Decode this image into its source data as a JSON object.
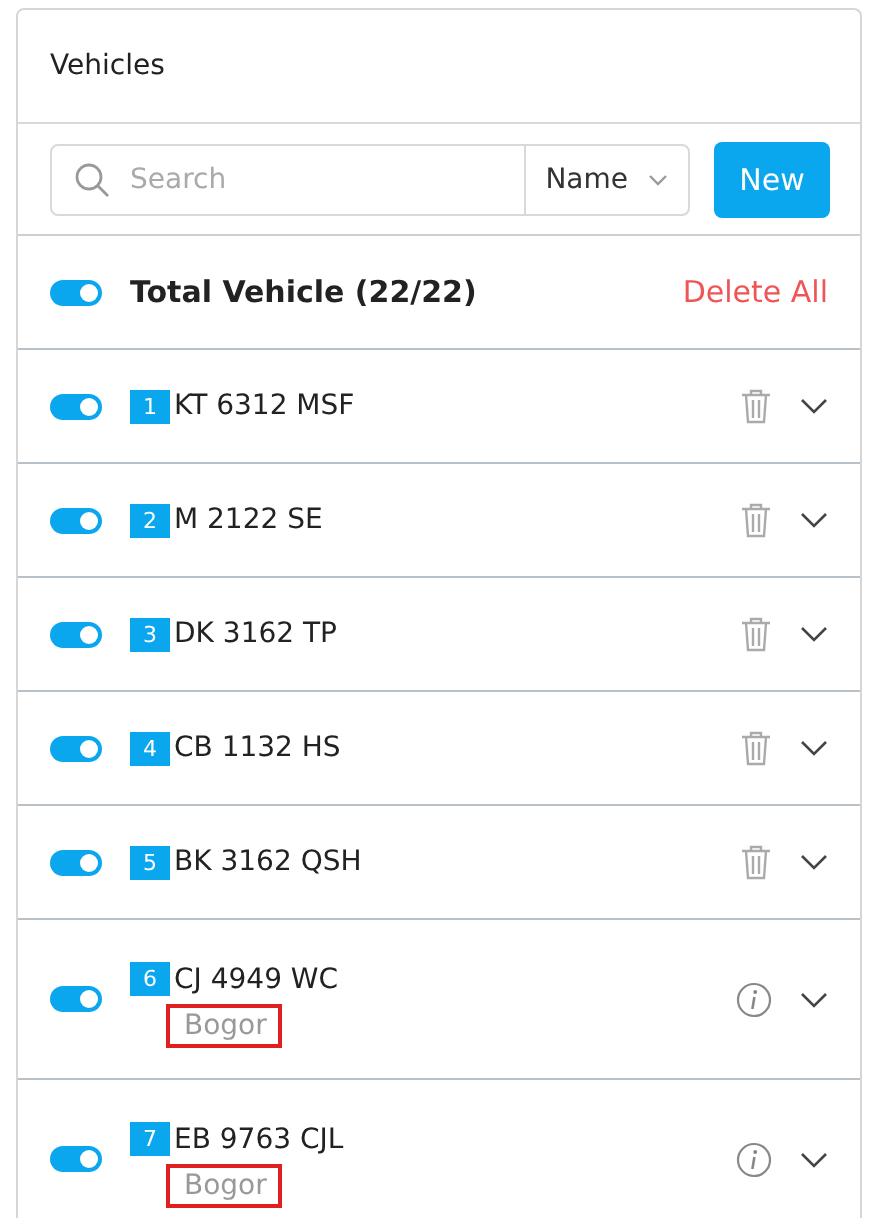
{
  "panel": {
    "title": "Vehicles"
  },
  "toolbar": {
    "search": {
      "placeholder": "Search"
    },
    "sort": {
      "value": "Name"
    },
    "new_button": "New"
  },
  "summary": {
    "label": "Total Vehicle (22/22)",
    "on": true,
    "delete_all": "Delete All"
  },
  "vehicles": [
    {
      "kind": "plain",
      "number": "1",
      "plate": "KT 6312 MSF",
      "on": true
    },
    {
      "kind": "plain",
      "number": "2",
      "plate": "M 2122 SE",
      "on": true
    },
    {
      "kind": "plain",
      "number": "3",
      "plate": "DK 3162 TP",
      "on": true
    },
    {
      "kind": "plain",
      "number": "4",
      "plate": "CB 1132 HS",
      "on": true
    },
    {
      "kind": "plain",
      "number": "5",
      "plate": "BK 3162 QSH",
      "on": true
    },
    {
      "kind": "located",
      "number": "6",
      "plate": "CJ 4949 WC",
      "location": "Bogor",
      "highlighted": true,
      "on": true
    },
    {
      "kind": "located",
      "number": "7",
      "plate": "EB 9763 CJL",
      "location": "Bogor",
      "highlighted": true,
      "on": true
    }
  ]
}
